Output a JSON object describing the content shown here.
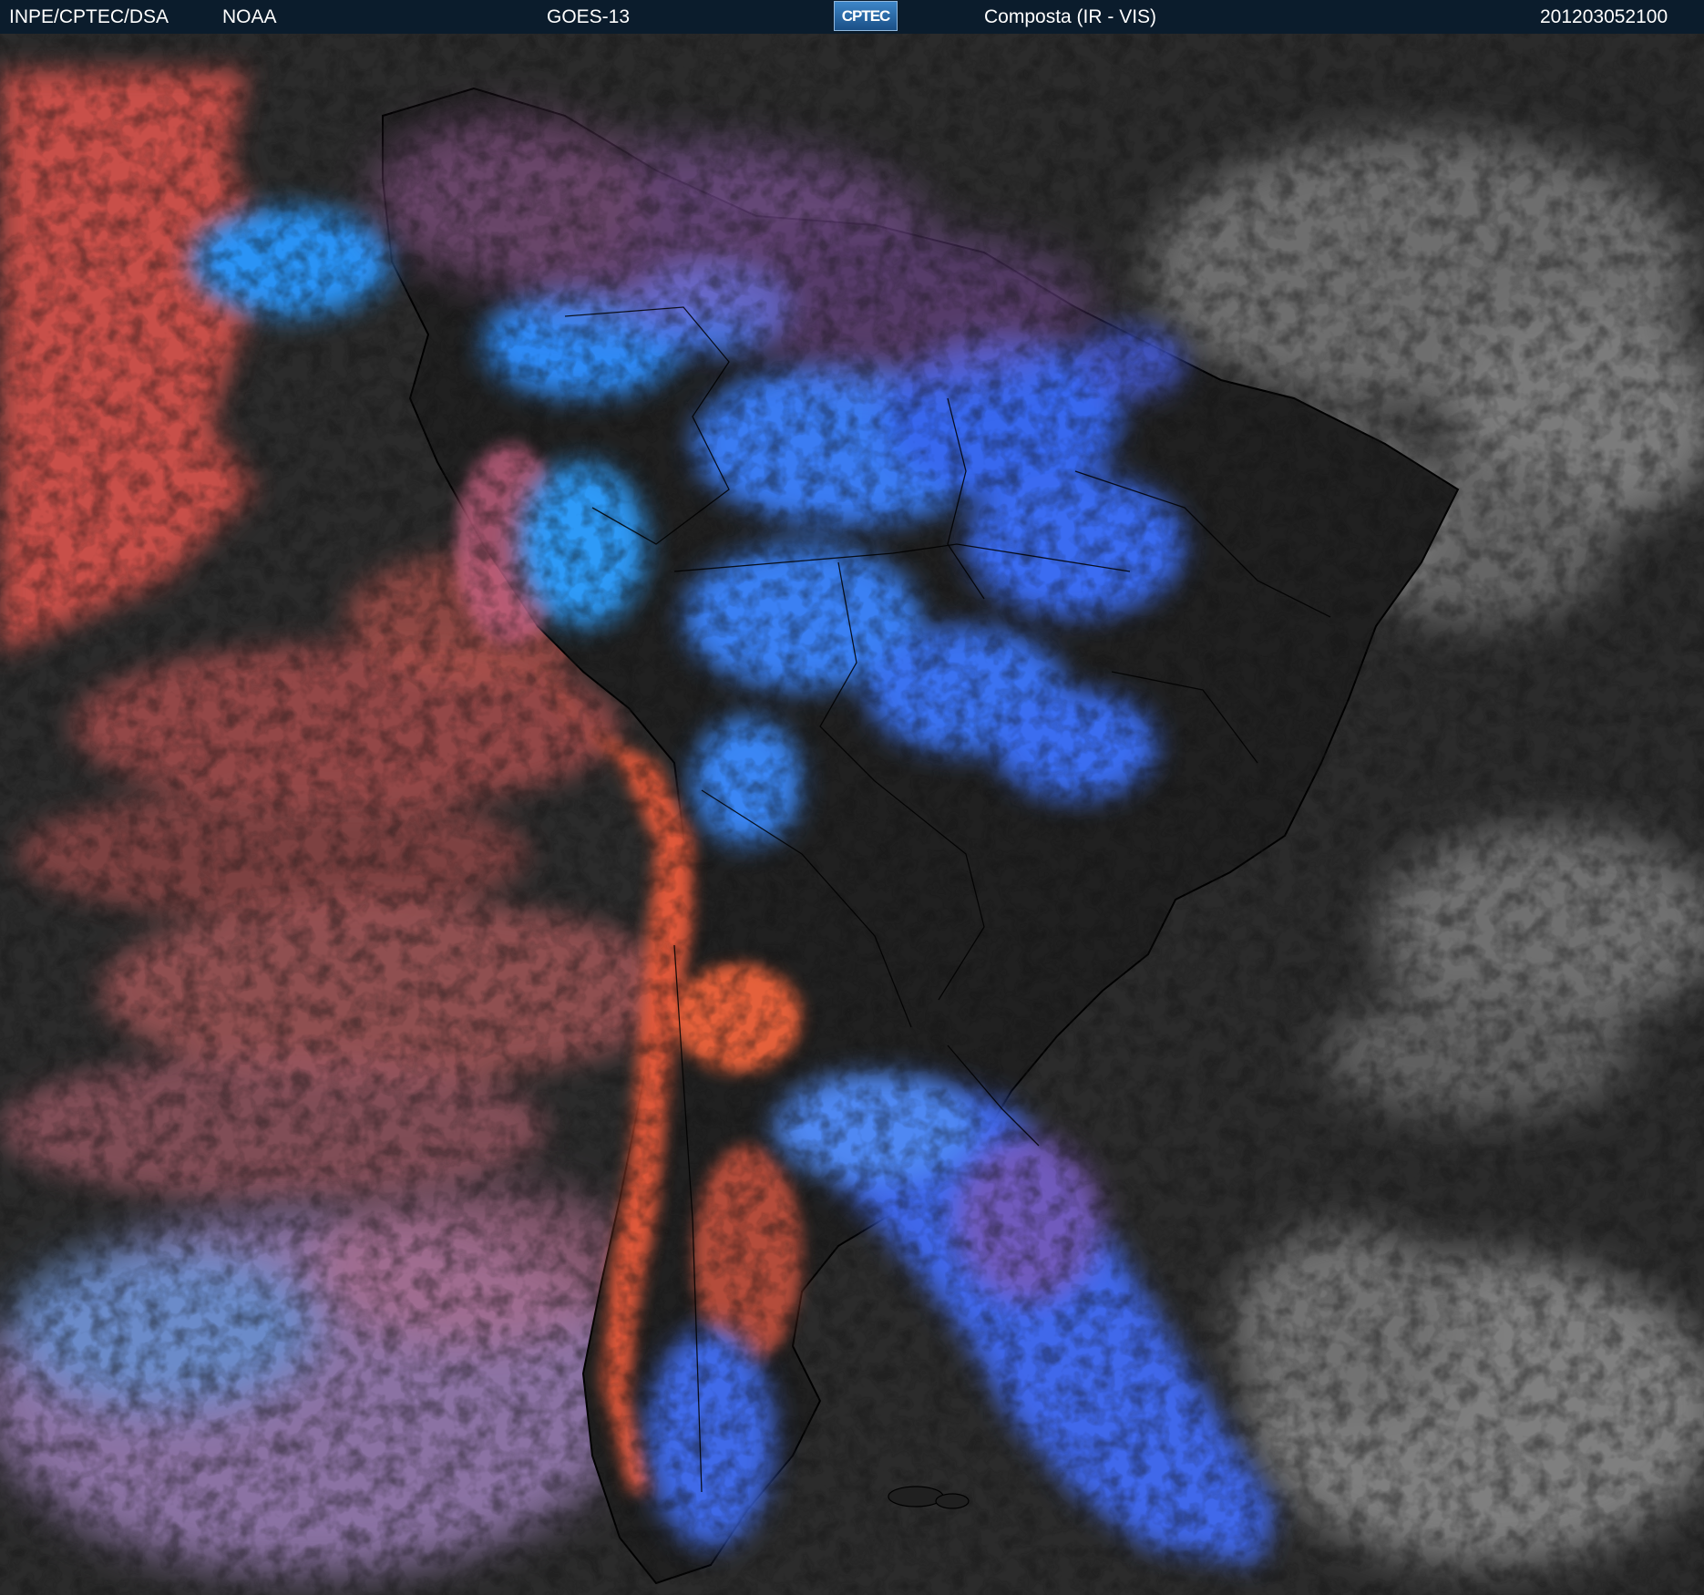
{
  "header": {
    "org": "INPE/CPTEC/DSA",
    "agency": "NOAA",
    "satellite": "GOES-13",
    "logo": "CPTEC",
    "product": "Composta (IR - VIS)",
    "timestamp": "201203052100"
  },
  "colors": {
    "header_bg": "#0b1c2c",
    "ocean": "#2b2b2b",
    "warm_cloud_red": "#c8524a",
    "cold_cloud_blue": "#2e7cf0",
    "bright_cyan": "#27a2ff",
    "low_cloud_gray": "#9a9a9a",
    "coastline": "#000000"
  }
}
